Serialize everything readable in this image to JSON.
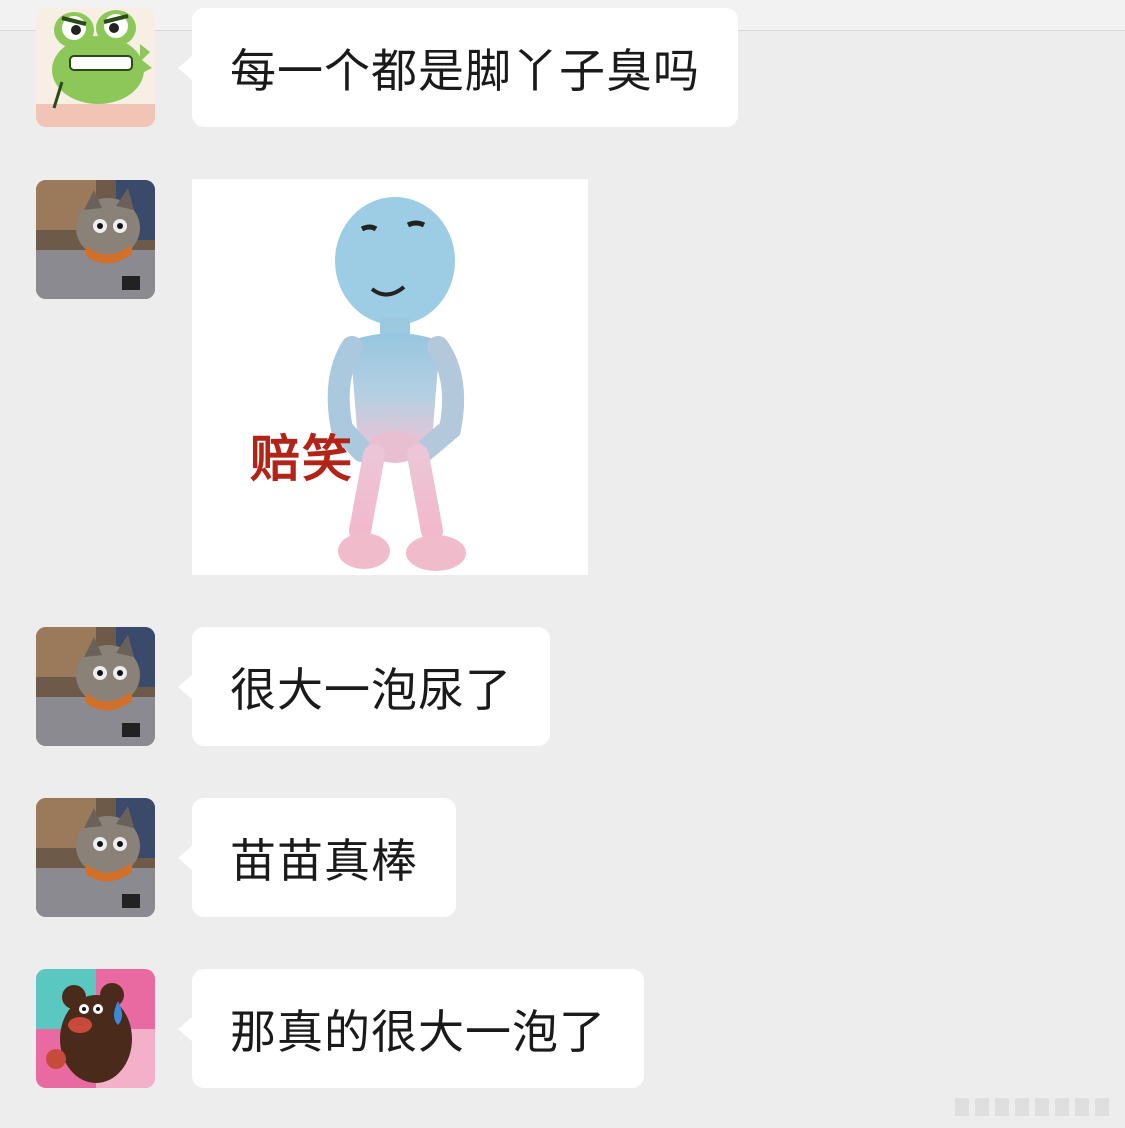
{
  "messages": [
    {
      "avatar": "frog-avatar",
      "type": "text",
      "text": "每一个都是脚丫子臭吗"
    },
    {
      "avatar": "cat-avatar",
      "type": "sticker",
      "sticker": "blue-figure-sticker",
      "caption": "赔笑"
    },
    {
      "avatar": "cat-avatar",
      "type": "text",
      "text": "很大一泡尿了"
    },
    {
      "avatar": "cat-avatar",
      "type": "text",
      "text": "苗苗真棒"
    },
    {
      "avatar": "bear-avatar",
      "type": "text",
      "text": "那真的很大一泡了"
    }
  ],
  "colors": {
    "background": "#ededed",
    "bubble": "#ffffff",
    "text": "#1a1a1a",
    "sticker_caption": "#b22418"
  }
}
